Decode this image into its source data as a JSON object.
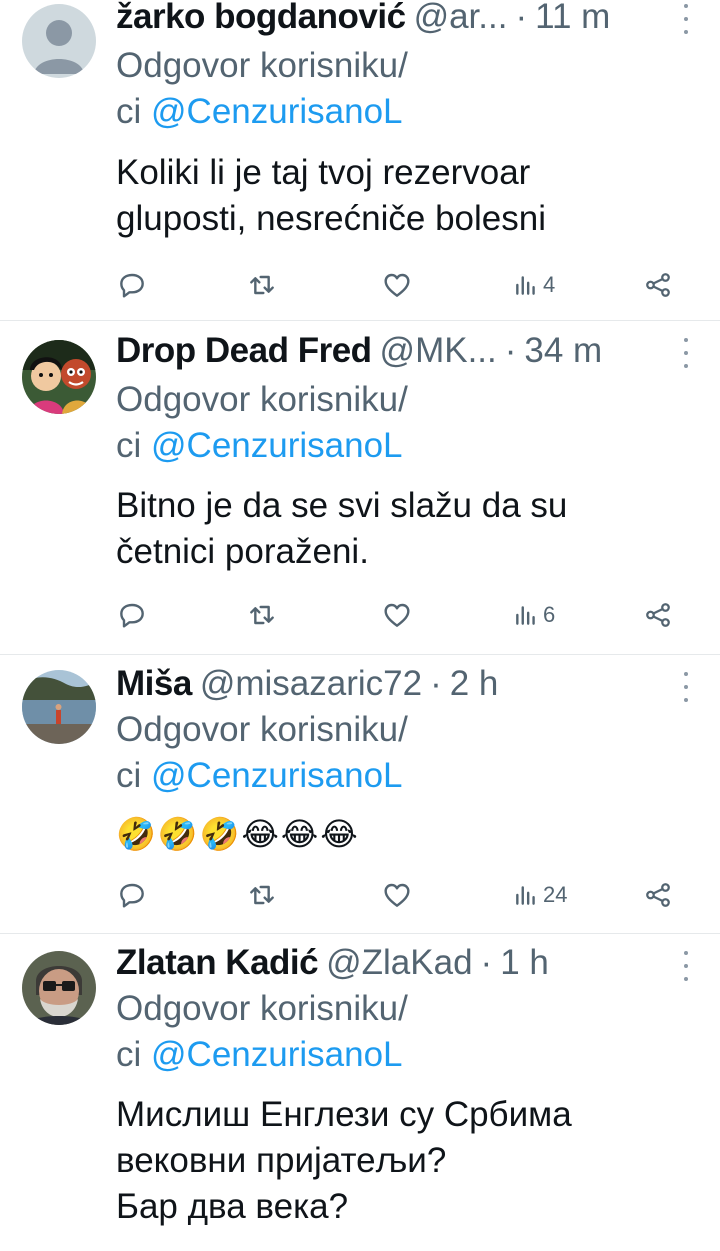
{
  "reply_prefix_line1": "Odgovor korisniku/",
  "reply_prefix_line2": "ci",
  "reply_mention": "@CenzurisanoL",
  "tweets": [
    {
      "name": "žarko bogdanović",
      "handle": "@ar...",
      "dot": "·",
      "time": "11 m",
      "lines": [
        "Koliki li je taj tvoj rezervoar",
        "gluposti, nesrećniče bolesni"
      ],
      "views": "4",
      "avatar": "default-avatar"
    },
    {
      "name": "Drop Dead Fred",
      "handle": "@MK...",
      "dot": "·",
      "time": "34 m",
      "lines": [
        "Bitno je da se svi slažu da su",
        "četnici poraženi."
      ],
      "views": "6",
      "avatar": "cartoon-avatar"
    },
    {
      "name": "Miša",
      "handle": "@misazaric72",
      "dot": "·",
      "time": "2 h",
      "emojis": [
        "🤣",
        "🤣",
        "🤣",
        "😂",
        "😂",
        "😂"
      ],
      "views": "24",
      "avatar": "beach-avatar"
    },
    {
      "name": "Zlatan Kadić",
      "handle": "@ZlaKad",
      "dot": "·",
      "time": "1 h",
      "lines": [
        "Мислиш Енглези су Србима",
        "вековни пријатељи?",
        "Бар два века?"
      ],
      "avatar": "man-glasses-avatar"
    }
  ],
  "colors": {
    "text": "#0f1419",
    "secondary": "#536471",
    "link": "#1d9bf0",
    "divider": "#e6e9eb"
  },
  "icons": [
    "reply-icon",
    "retweet-icon",
    "like-icon",
    "views-icon",
    "share-icon",
    "more-icon"
  ]
}
